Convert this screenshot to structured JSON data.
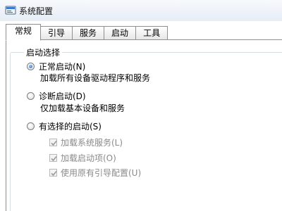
{
  "window": {
    "title": "系统配置"
  },
  "tabs": [
    {
      "label": "常规",
      "selected": true
    },
    {
      "label": "引导",
      "selected": false
    },
    {
      "label": "服务",
      "selected": false
    },
    {
      "label": "启动",
      "selected": false
    },
    {
      "label": "工具",
      "selected": false
    }
  ],
  "startup_selection": {
    "group_label": "启动选择",
    "options": [
      {
        "label": "正常启动(N)",
        "description": "加载所有设备驱动程序和服务",
        "checked": true
      },
      {
        "label": "诊断启动(D)",
        "description": "仅加载基本设备和服务",
        "checked": false
      },
      {
        "label": "有选择的启动(S)",
        "checked": false
      }
    ],
    "selective_items": [
      {
        "label": "加载系统服务(L)",
        "checked": true,
        "enabled": false
      },
      {
        "label": "加载启动项(O)",
        "checked": true,
        "enabled": false
      },
      {
        "label": "使用原有引导配置(U)",
        "checked": true,
        "enabled": false
      }
    ]
  },
  "icons": {
    "title": "system-config-icon",
    "radio": "radio-button",
    "checkbox": "checkmark-icon"
  }
}
